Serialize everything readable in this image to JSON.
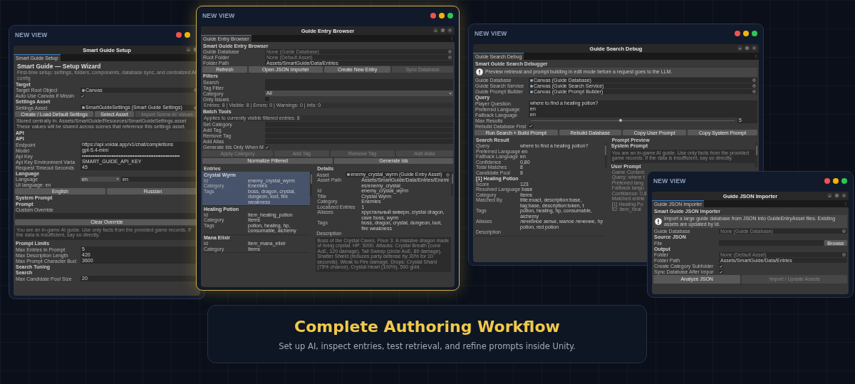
{
  "windows": [
    {
      "frame_title": "NEW VIEW",
      "lights": [
        {
          "color": "#ef5350"
        },
        {
          "color": "#f4b400"
        }
      ],
      "title": "Smart Guide Setup",
      "controls": [
        {
          "kind": "minimize"
        },
        {
          "kind": "maximize"
        }
      ],
      "tab": "Smart Guide Setup",
      "tab_menu": false,
      "highlighted": false,
      "rows": [
        {
          "kind": "wizard_title",
          "text": "Smart Guide — Setup Wizard",
          "subtitle": "First-time setup: settings, folders, components, database sync, and centralized AI config"
        },
        {
          "kind": "header",
          "text": "Target"
        },
        {
          "kind": "object",
          "label": "Target Root Object",
          "value": "Canvas",
          "asset_icon": true,
          "dim": false
        },
        {
          "kind": "toggle",
          "label": "Auto Use Canvas If Missin",
          "checked": true
        },
        {
          "kind": "header",
          "text": "Settings Asset"
        },
        {
          "kind": "object",
          "label": "Settings Asset",
          "value": "SmartGuideSettings (Smart Guide Settings)",
          "asset_icon": true,
          "dim": false
        },
        {
          "kind": "buttons",
          "buttons": [
            {
              "label": "Create / Load Default Settings",
              "disabled": false
            },
            {
              "label": "Select Asset",
              "disabled": false
            },
            {
              "label": "Import Scene AI Values",
              "disabled": true
            }
          ]
        },
        {
          "kind": "note",
          "lines": [
            "Stored centrally in: Assets/SmartGuide/Resources/SmartGuideSettings.asset",
            "These values will be shared across scenes that reference this settings asset."
          ]
        },
        {
          "kind": "header",
          "text": "API"
        },
        {
          "kind": "header",
          "text": "API"
        },
        {
          "kind": "field",
          "label": "Endpoint",
          "value": "https://api.voidai.app/v1/chat/completions"
        },
        {
          "kind": "field",
          "label": "Model",
          "value": "gpt-5.4-mini"
        },
        {
          "kind": "field",
          "label": "Api Key",
          "value": "••••••••••••••••••••••••••••••••••••••••••••••••••••••••"
        },
        {
          "kind": "field",
          "label": "Api Key Environment Varia",
          "value": "SMART_GUIDE_API_KEY"
        },
        {
          "kind": "field",
          "label": "Request Timeout Seconds",
          "value": "45"
        },
        {
          "kind": "header",
          "text": "Language"
        },
        {
          "kind": "dropdown_pair",
          "label": "Language",
          "value": "en",
          "text": "en"
        },
        {
          "kind": "label",
          "text": "UI language: en"
        },
        {
          "kind": "buttons",
          "buttons": [
            {
              "label": "English",
              "disabled": false
            },
            {
              "label": "Russian",
              "disabled": false
            }
          ]
        },
        {
          "kind": "header",
          "text": "System Prompt"
        },
        {
          "kind": "header",
          "text": "Prompt"
        },
        {
          "kind": "label",
          "text": "Custom Override"
        },
        {
          "kind": "field"
        },
        {
          "kind": "buttons",
          "buttons": [
            {
              "label": "Clear Override",
              "disabled": false
            }
          ]
        },
        {
          "kind": "textarea",
          "text": "You are an in-game AI guide. Use only facts from the provided game records. If the data is insufficient, say so directly."
        },
        {
          "kind": "header",
          "text": "Prompt Limits"
        },
        {
          "kind": "field",
          "label": "Max Entries In Prompt",
          "value": "5"
        },
        {
          "kind": "field",
          "label": "Max Description Length",
          "value": "420"
        },
        {
          "kind": "field",
          "label": "Max Prompt Character Bud",
          "value": "3600"
        },
        {
          "kind": "header",
          "text": "Search Tuning"
        },
        {
          "kind": "header",
          "text": "Search"
        },
        {
          "kind": "field",
          "label": "Max Candidate Pool Size",
          "value": "20"
        }
      ]
    },
    {
      "frame_title": "NEW VIEW",
      "lights": [
        {
          "color": "#ef5350"
        },
        {
          "color": "#f4b400"
        },
        {
          "color": "#2fc654"
        }
      ],
      "title": "Guide Entry Browser",
      "controls": [
        {
          "kind": "minimize"
        },
        {
          "kind": "maximize"
        },
        {
          "kind": "close"
        }
      ],
      "tab": "Guide Entry Browser",
      "tab_menu": true,
      "highlighted": true,
      "rows": [
        {
          "kind": "header",
          "text": "Smart Guide Entry Browser"
        },
        {
          "kind": "object",
          "label": "Guide Database",
          "value": "None (Guide Database)",
          "asset_icon": false,
          "dim": true
        },
        {
          "kind": "object",
          "label": "Root Folder",
          "value": "None (Default Asset)",
          "asset_icon": false,
          "dim": true
        },
        {
          "kind": "field",
          "label": "Folder Path",
          "value": "Assets/SmartGuide/Data/Entries"
        },
        {
          "kind": "buttons",
          "buttons": [
            {
              "label": "Refresh",
              "disabled": false
            },
            {
              "label": "Open JSON Importer",
              "disabled": false
            },
            {
              "label": "Create New Entry",
              "disabled": false
            },
            {
              "label": "Sync Database",
              "disabled": true
            }
          ]
        },
        {
          "kind": "header",
          "text": "Filters"
        },
        {
          "kind": "field",
          "label": "Search"
        },
        {
          "kind": "field",
          "label": "Tag Filter"
        },
        {
          "kind": "dropdown",
          "label": "Category",
          "value": "All"
        },
        {
          "kind": "toggle",
          "label": "Only Issues",
          "checked": false
        },
        {
          "kind": "note",
          "lines": [
            "Entries: 8 | Visible: 8 | Errors: 0 | Warnings: 0 | Info: 0"
          ]
        },
        {
          "kind": "header",
          "text": "Batch Tools"
        },
        {
          "kind": "note",
          "lines": [
            "Applies to currently visible filtered entries: 8"
          ]
        },
        {
          "kind": "field",
          "label": "Set Category"
        },
        {
          "kind": "field",
          "label": "Add Tag"
        },
        {
          "kind": "field",
          "label": "Remove Tag"
        },
        {
          "kind": "field",
          "label": "Add Alias"
        },
        {
          "kind": "toggle",
          "label": "Generate Ids Only When M",
          "checked": true
        },
        {
          "kind": "buttons",
          "buttons": [
            {
              "label": "Apply Category",
              "disabled": true
            },
            {
              "label": "Add Tag",
              "disabled": true
            },
            {
              "label": "Remove Tag",
              "disabled": true
            },
            {
              "label": "Add Alias",
              "disabled": true
            }
          ]
        },
        {
          "kind": "buttons",
          "buttons": [
            {
              "label": "Normalize Filtered",
              "disabled": false
            },
            {
              "label": "Generate Ids",
              "disabled": false
            }
          ]
        },
        {
          "kind": "split",
          "left": {
            "title": "Entries",
            "rows": [
              {
                "kind": "group",
                "title": "Crystal Wyrm",
                "selected": true,
                "pairs": [
                  {
                    "label": "Id",
                    "value": "enemy_crystal_wyrm"
                  },
                  {
                    "label": "Category",
                    "value": "Enemies"
                  },
                  {
                    "label": "Tags",
                    "value": "boss, dragon, crystal, dungeon, loot, fire weakness"
                  }
                ]
              },
              {
                "kind": "group",
                "title": "Healing Potion",
                "selected": false,
                "pairs": [
                  {
                    "label": "Id",
                    "value": "item_healing_potion"
                  },
                  {
                    "label": "Category",
                    "value": "Items"
                  },
                  {
                    "label": "Tags",
                    "value": "potion, healing, hp, consumable, alchemy"
                  }
                ]
              },
              {
                "kind": "group",
                "title": "Mana Elixir",
                "selected": false,
                "pairs": [
                  {
                    "label": "Id",
                    "value": "item_mana_elixir"
                  },
                  {
                    "label": "Category",
                    "value": "Items"
                  }
                ]
              }
            ]
          },
          "right": {
            "title": "Details",
            "rows": [
              {
                "kind": "object",
                "label": "Asset",
                "value": "enemy_crystal_wyrm (Guide Entry Asset)",
                "asset_icon": true,
                "dim": false
              },
              {
                "kind": "pairs",
                "pairs": [
                  {
                    "label": "Asset Path",
                    "value": "Assets/SmartGuide/Data/Entries/Enemies/enemy_crystal_"
                  },
                  {
                    "label": "Id",
                    "value": "enemy_crystal_wyrm"
                  },
                  {
                    "label": "Title",
                    "value": "Crystal Wyrm"
                  },
                  {
                    "label": "Category",
                    "value": "Enemies"
                  },
                  {
                    "label": "Localized Entries",
                    "value": "1"
                  },
                  {
                    "label": "Aliases",
                    "value": "хрустальный виверн, crystal dragon, cave boss, wyrm"
                  },
                  {
                    "label": "Tags",
                    "value": "boss, dragon, crystal, dungeon, loot, fire weakness"
                  }
                ]
              },
              {
                "kind": "label",
                "text": "Description"
              },
              {
                "kind": "textarea",
                "text": "Boss of the Crystal Caves, Floor 3. A massive dragon made of living crystal. HP: 5000. Attacks: Crystal Breath (cone AoE, 120 damage), Tail Sweep (circle AoE, 80 damage), Shatter Shield (reduces party defense by 30% for 10 seconds). Weak to Fire damage. Drops: Crystal Shard (75% chance), Crystal Heart (100%), 500 gold."
              }
            ]
          }
        }
      ]
    },
    {
      "frame_title": "NEW VIEW",
      "lights": [
        {
          "color": "#ef5350"
        },
        {
          "color": "#f4b400"
        },
        {
          "color": "#2fc654"
        }
      ],
      "title": "Guide Search Debug",
      "controls": [
        {
          "kind": "minimize"
        },
        {
          "kind": "maximize"
        },
        {
          "kind": "close"
        }
      ],
      "tab": "Guide Search Debug",
      "tab_menu": true,
      "highlighted": false,
      "rows": [
        {
          "kind": "header",
          "text": "Smart Guide Search Debugger"
        },
        {
          "kind": "help",
          "text": "Preview retrieval and prompt building in edit mode before a request goes to the LLM."
        },
        {
          "kind": "object",
          "label": "Guide Database",
          "value": "Canvas (Guide Database)",
          "asset_icon": true,
          "dim": false
        },
        {
          "kind": "object",
          "label": "Guide Search Service",
          "value": "Canvas (Guide Search Service)",
          "asset_icon": true,
          "dim": false
        },
        {
          "kind": "object",
          "label": "Guide Prompt Builder",
          "value": "Canvas (Guide Prompt Builder)",
          "asset_icon": true,
          "dim": false
        },
        {
          "kind": "header",
          "text": "Query"
        },
        {
          "kind": "field",
          "label": "Player Question",
          "value": "where to find a healing potion?"
        },
        {
          "kind": "field",
          "label": "Preferred Language",
          "value": "en"
        },
        {
          "kind": "field",
          "label": "Fallback Language",
          "value": "en"
        },
        {
          "kind": "slider",
          "label": "Max Results",
          "level": 0.44,
          "reading": "5"
        },
        {
          "kind": "toggle",
          "label": "Rebuild Database First",
          "checked": true
        },
        {
          "kind": "buttons",
          "buttons": [
            {
              "label": "Run Search + Build Prompt",
              "disabled": false
            },
            {
              "label": "Rebuild Database",
              "disabled": false
            },
            {
              "label": "Copy User Prompt",
              "disabled": false
            },
            {
              "label": "Copy System Prompt",
              "disabled": false
            }
          ]
        },
        {
          "kind": "split",
          "left": {
            "title": "Search Result",
            "rows": [
              {
                "kind": "pairs",
                "pairs": [
                  {
                    "label": "Query",
                    "value": "where to find a healing potion?"
                  },
                  {
                    "label": "Preferred Language",
                    "value": "en"
                  },
                  {
                    "label": "Fallback Language",
                    "value": "en"
                  },
                  {
                    "label": "Confidence",
                    "value": "0,80"
                  },
                  {
                    "label": "Total Matches",
                    "value": "8"
                  },
                  {
                    "label": "Candidate Pool",
                    "value": "8"
                  }
                ]
              },
              {
                "kind": "group",
                "title": "[1] Healing Potion",
                "selected": false,
                "pairs": [
                  {
                    "label": "Score",
                    "value": "123"
                  },
                  {
                    "label": "Resolved Language",
                    "value": "base"
                  },
                  {
                    "label": "Category",
                    "value": "Items"
                  },
                  {
                    "label": "Matched By",
                    "value": "title:exact, description:base, tag:base, description:token, t"
                  },
                  {
                    "label": "Tags",
                    "value": "potion, healing, hp, consumable, alchemy"
                  },
                  {
                    "label": "Aliases",
                    "value": "лечебное зелье, малое лечение, hp potion, red potion"
                  },
                  {
                    "label": "Description"
                  }
                ]
              }
            ]
          },
          "right": {
            "title": "Prompt Preview",
            "rows": [
              {
                "kind": "subheader",
                "text": "System Prompt"
              },
              {
                "kind": "textarea",
                "text": "You are an in-game AI guide. Use only facts from the provided game records. If the data is insufficient, say so directly."
              },
              {
                "kind": "subheader",
                "text": "User Prompt"
              },
              {
                "kind": "lines",
                "lines": [
                  "Game Context:",
                  "Query: where t",
                  "Preferred lang",
                  "Fallback langu",
                  "Confidence: 0,8",
                  "Matched entrie",
                  "[1] Healing Po",
                  "ID: item_heal"
                ]
              }
            ]
          }
        }
      ]
    },
    {
      "frame_title": "NEW VIEW",
      "lights": [
        {
          "color": "#ef5350"
        },
        {
          "color": "#f4b400"
        },
        {
          "color": "#2fc654"
        }
      ],
      "title": "Guide JSON Importer",
      "controls": [
        {
          "kind": "minimize"
        },
        {
          "kind": "maximize"
        },
        {
          "kind": "close"
        }
      ],
      "tab": "Guide JSON Importer",
      "tab_menu": true,
      "highlighted": false,
      "rows": [
        {
          "kind": "header",
          "text": "Smart Guide JSON Importer"
        },
        {
          "kind": "help",
          "text": "Import a large guide database from JSON into GuideEntryAsset files. Existing assets are updated by Id."
        },
        {
          "kind": "object",
          "label": "Guide Database",
          "value": "None (Guide Database)",
          "asset_icon": false,
          "dim": true
        },
        {
          "kind": "header",
          "text": "Source JSON"
        },
        {
          "kind": "file",
          "label": "File",
          "button": "Browse"
        },
        {
          "kind": "header",
          "text": "Output"
        },
        {
          "kind": "object",
          "label": "Folder",
          "value": "None (Default Asset)",
          "asset_icon": false,
          "dim": true
        },
        {
          "kind": "field",
          "label": "Folder Path",
          "value": "Assets/SmartGuide/Data/Entries"
        },
        {
          "kind": "toggle",
          "label": "Create Category Subfolder",
          "checked": true
        },
        {
          "kind": "toggle",
          "label": "Sync Database After Impor",
          "checked": true
        },
        {
          "kind": "buttons",
          "buttons": [
            {
              "label": "Analyze JSON",
              "disabled": false
            },
            {
              "label": "Import / Update Assets",
              "disabled": true
            }
          ]
        }
      ]
    }
  ],
  "banner": {
    "title": "Complete Authoring Workflow",
    "subtitle": "Set up AI, inspect entries, test retrieval, and refine prompts inside Unity."
  }
}
